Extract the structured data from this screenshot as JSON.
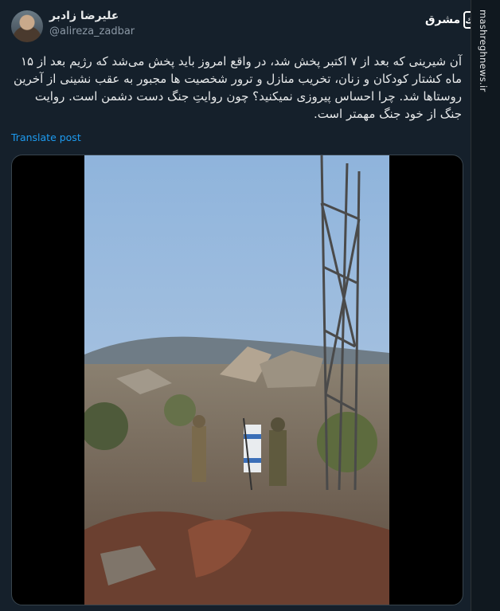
{
  "author": {
    "display_name": "علیرضا زادبر",
    "handle": "@alireza_zadbar"
  },
  "brand": {
    "box_text": "ك",
    "word": "مشرق"
  },
  "post": {
    "text": "آن شیرینی که بعد از ۷ اکتبر پخش شد، در واقع امروز باید پخش می‌شد که رژیم بعد از ۱۵ ماه کشتار کودکان و زنان، تخریب منازل و ترور شخصیت ها مجبور به عقب نشینی از آخرین روستاها شد. چرا احساس پیروزی نمیکنید؟ چون روایتِ جنگ دست دشمن است. روایت جنگ از خود جنگ مهمتر است.",
    "translate_label": "Translate post"
  },
  "sidebar": {
    "watermark": "mashreghnews.ir"
  }
}
